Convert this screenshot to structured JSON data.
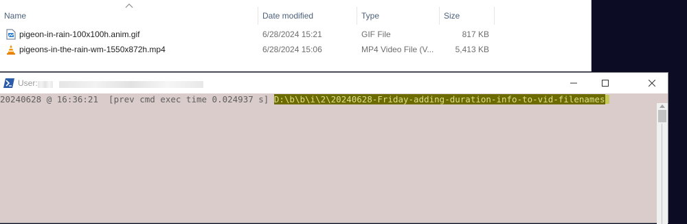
{
  "explorer": {
    "columns": {
      "name": "Name",
      "date_modified": "Date modified",
      "type": "Type",
      "size": "Size"
    },
    "files": [
      {
        "icon": "gif-image-file-icon",
        "name": "pigeon-in-rain-100x100h.anim.gif",
        "date": "6/28/2024 15:21",
        "type": "GIF File",
        "size": "817 KB"
      },
      {
        "icon": "vlc-media-file-icon",
        "name": "pigeons-in-the-rain-wm-1550x872h.mp4",
        "date": "6/28/2024 15:06",
        "type": "MP4 Video File (V...",
        "size": "5,413 KB"
      }
    ]
  },
  "terminal": {
    "title": "User:",
    "icon": "powershell-icon",
    "prompt": {
      "info": "20240628 @ 16:36:21  [prev cmd exec time 0.024937 s] ",
      "path": "D:\\b\\b\\i\\2\\20240628-Friday-adding-duration-info-to-vid-filenames"
    },
    "colors": {
      "background": "#dbcccc",
      "path_highlight": "#6b6b00",
      "path_text": "#dede90"
    }
  }
}
